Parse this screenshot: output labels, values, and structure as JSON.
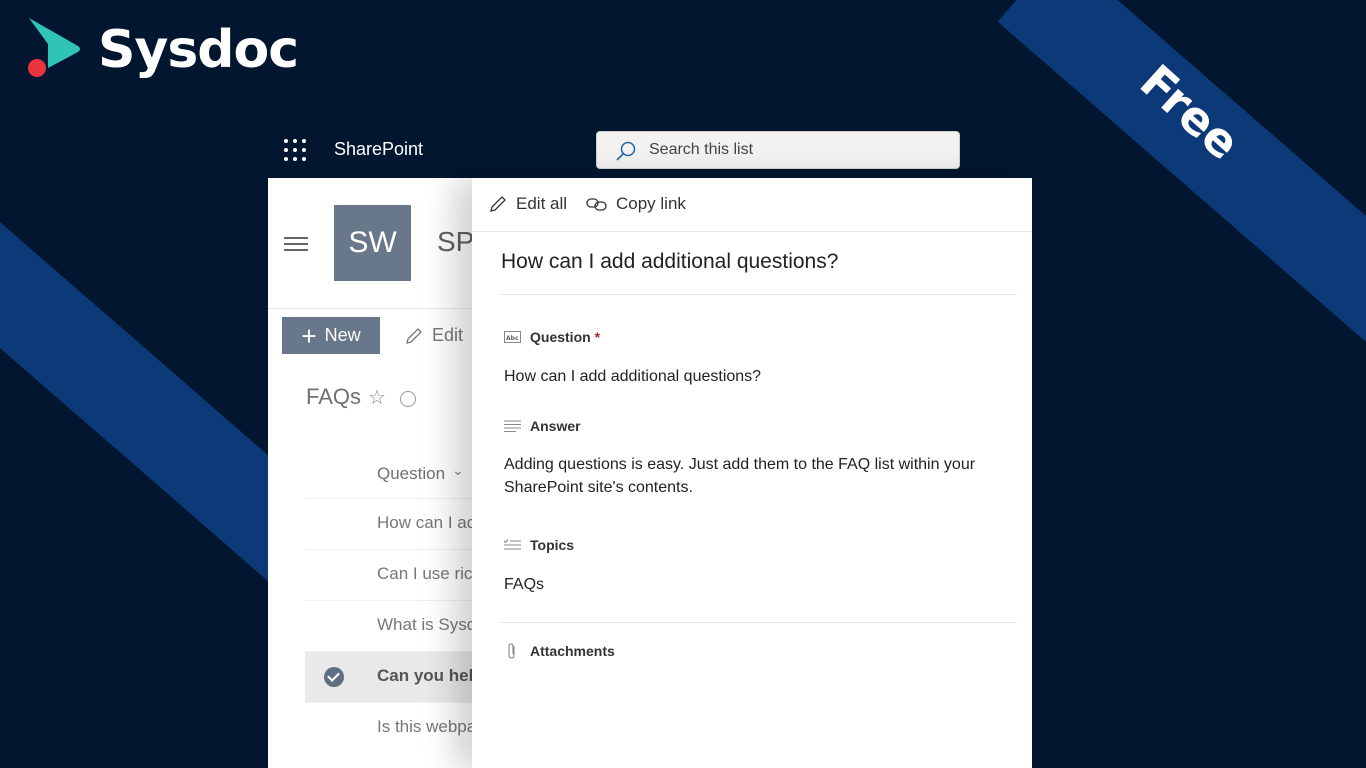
{
  "brand": {
    "name": "Sysdoc",
    "ribbon": "Free"
  },
  "suitebar": {
    "app_name": "SharePoint",
    "search_placeholder": "Search this list"
  },
  "site": {
    "logo_initials": "SW",
    "title_partial": "SP"
  },
  "commands": {
    "new_label": "New",
    "edit_label": "Edit"
  },
  "list": {
    "title": "FAQs",
    "column_header": "Question",
    "rows": [
      {
        "text": "How can I ad",
        "selected": false
      },
      {
        "text": "Can I use rich",
        "selected": false
      },
      {
        "text": "What is Sysdo",
        "selected": false
      },
      {
        "text": "Can you help",
        "selected": true
      },
      {
        "text": "Is this webpa",
        "selected": false
      }
    ]
  },
  "panel": {
    "edit_all_label": "Edit all",
    "copy_link_label": "Copy link",
    "heading": "How can I add additional questions?",
    "fields": {
      "question": {
        "label": "Question",
        "required_mark": "*",
        "value": "How can I add additional questions?"
      },
      "answer": {
        "label": "Answer",
        "value": "Adding questions is easy. Just add them to the FAQ list within your SharePoint site's contents."
      },
      "topics": {
        "label": "Topics",
        "value": "FAQs"
      },
      "attachments": {
        "label": "Attachments"
      }
    }
  },
  "colors": {
    "background": "#021630",
    "stripe": "#0c3a78",
    "accent_red": "#e8343d",
    "accent_teal": "#2ec4b6"
  }
}
